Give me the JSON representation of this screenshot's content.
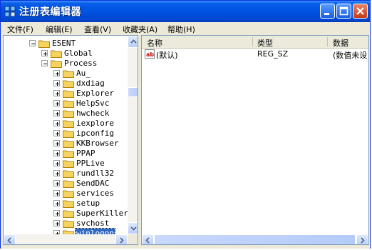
{
  "window": {
    "title": "注册表编辑器"
  },
  "menu": [
    {
      "label": "文件(F)"
    },
    {
      "label": "编辑(E)"
    },
    {
      "label": "查看(V)"
    },
    {
      "label": "收藏夹(A)"
    },
    {
      "label": "帮助(H)"
    }
  ],
  "tree": {
    "nodes": [
      {
        "label": "ESENT",
        "expander": "minus"
      },
      {
        "label": "Global",
        "expander": "plus"
      },
      {
        "label": "Process",
        "expander": "minus"
      },
      {
        "label": "Au_",
        "expander": "plus"
      },
      {
        "label": "dxdiag",
        "expander": "plus"
      },
      {
        "label": "Explorer",
        "expander": "plus"
      },
      {
        "label": "HelpSvc",
        "expander": "plus"
      },
      {
        "label": "hwcheck",
        "expander": "plus"
      },
      {
        "label": "iexplore",
        "expander": "plus"
      },
      {
        "label": "ipconfig",
        "expander": "plus"
      },
      {
        "label": "KKBrowser",
        "expander": "plus"
      },
      {
        "label": "PPAP",
        "expander": "plus"
      },
      {
        "label": "PPLive",
        "expander": "plus"
      },
      {
        "label": "rundll32",
        "expander": "plus"
      },
      {
        "label": "SendDAC",
        "expander": "plus"
      },
      {
        "label": "services",
        "expander": "plus"
      },
      {
        "label": "setup",
        "expander": "plus"
      },
      {
        "label": "SuperKiller",
        "expander": "plus"
      },
      {
        "label": "svchost",
        "expander": "plus"
      },
      {
        "label": "winlogon",
        "expander": "plus",
        "selected": true
      }
    ]
  },
  "list": {
    "columns": [
      "名称",
      "类型",
      "数据"
    ],
    "rows": [
      {
        "name": "(默认)",
        "type": "REG_SZ",
        "data": "(数值未设"
      }
    ]
  },
  "colors": {
    "titlebar": "#0055e5",
    "selection": "#316ac5",
    "folder": "#f5d35c"
  }
}
